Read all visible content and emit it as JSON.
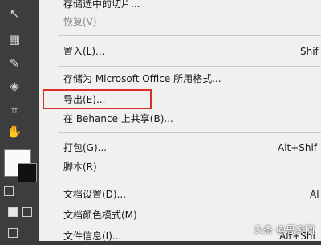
{
  "toolbar": {
    "icons": [
      "selection-icon",
      "image-trace-icon",
      "eyedropper-icon",
      "perspective-icon",
      "artboard-icon",
      "hand-icon"
    ]
  },
  "menu": {
    "items": [
      {
        "label": "存储选中的切片...",
        "shortcut": "",
        "disabled": false
      },
      {
        "label": "恢复(V)",
        "shortcut": "",
        "disabled": true
      },
      {
        "label": "置入(L)...",
        "shortcut": "Shif",
        "disabled": false
      },
      {
        "label": "存储为 Microsoft Office 所用格式...",
        "shortcut": "",
        "disabled": false
      },
      {
        "label": "导出(E)...",
        "shortcut": "",
        "disabled": false
      },
      {
        "label": "在 Behance 上共享(B)...",
        "shortcut": "",
        "disabled": false
      },
      {
        "label": "打包(G)...",
        "shortcut": "Alt+Shif",
        "disabled": false
      },
      {
        "label": "脚本(R)",
        "shortcut": "",
        "disabled": false
      },
      {
        "label": "文档设置(D)...",
        "shortcut": "Al",
        "disabled": false
      },
      {
        "label": "文档颜色模式(M)",
        "shortcut": "",
        "disabled": false
      },
      {
        "label": "文件信息(I)...",
        "shortcut": "Alt+Shi",
        "disabled": false
      }
    ]
  },
  "highlight_color": "#d9302a",
  "watermark": "头条 @思爽网"
}
